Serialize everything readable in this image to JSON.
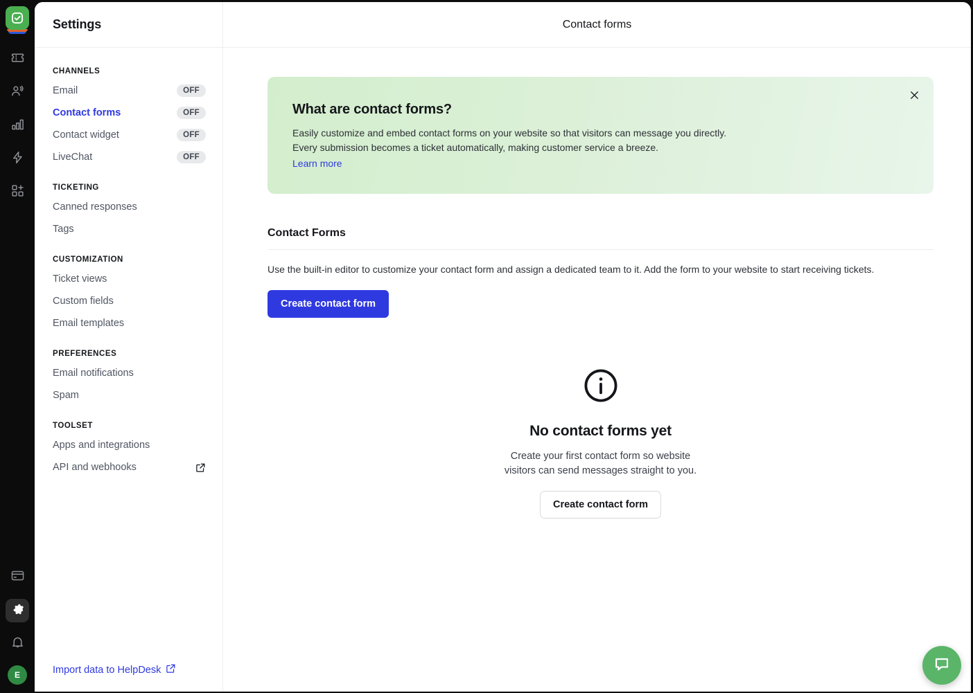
{
  "rail": {
    "logo_name": "helpdesk-logo",
    "items": [
      {
        "name": "tickets",
        "icon": "ticket-icon"
      },
      {
        "name": "teams",
        "icon": "people-icon"
      },
      {
        "name": "reports",
        "icon": "bar-chart-icon"
      },
      {
        "name": "automations",
        "icon": "lightning-bolt-icon"
      },
      {
        "name": "apps",
        "icon": "apps-grid-plus-icon"
      }
    ],
    "bottom_items": [
      {
        "name": "billing",
        "icon": "credit-card-icon",
        "active": false
      },
      {
        "name": "settings",
        "icon": "gear-icon",
        "active": true
      },
      {
        "name": "notifications",
        "icon": "bell-icon",
        "active": false
      }
    ],
    "avatar_initial": "E"
  },
  "topbar": {
    "settings_title": "Settings",
    "page_title": "Contact forms"
  },
  "sidebar": {
    "groups": [
      {
        "label": "CHANNELS",
        "items": [
          {
            "label": "Email",
            "badge": "OFF",
            "active": false
          },
          {
            "label": "Contact forms",
            "badge": "OFF",
            "active": true
          },
          {
            "label": "Contact widget",
            "badge": "OFF",
            "active": false
          },
          {
            "label": "LiveChat",
            "badge": "OFF",
            "active": false
          }
        ]
      },
      {
        "label": "TICKETING",
        "items": [
          {
            "label": "Canned responses",
            "badge": null,
            "active": false
          },
          {
            "label": "Tags",
            "badge": null,
            "active": false
          }
        ]
      },
      {
        "label": "CUSTOMIZATION",
        "items": [
          {
            "label": "Ticket views",
            "badge": null,
            "active": false
          },
          {
            "label": "Custom fields",
            "badge": null,
            "active": false
          },
          {
            "label": "Email templates",
            "badge": null,
            "active": false
          }
        ]
      },
      {
        "label": "PREFERENCES",
        "items": [
          {
            "label": "Email notifications",
            "badge": null,
            "active": false
          },
          {
            "label": "Spam",
            "badge": null,
            "active": false
          }
        ]
      },
      {
        "label": "TOOLSET",
        "items": [
          {
            "label": "Apps and integrations",
            "badge": null,
            "active": false
          },
          {
            "label": "API and webhooks",
            "badge": null,
            "active": false,
            "external": true
          }
        ]
      }
    ],
    "footer_link": "Import data to HelpDesk"
  },
  "banner": {
    "heading": "What are contact forms?",
    "text": "Easily customize and embed contact forms on your website so that visitors can message you directly. Every submission becomes a ticket automatically, making customer service a breeze.",
    "link": "Learn more",
    "close_label": "Close"
  },
  "section": {
    "heading": "Contact Forms",
    "description": "Use the built-in editor to customize your contact form and assign a dedicated team to it. Add the form to your website to start receiving tickets.",
    "primary_button": "Create contact form"
  },
  "empty_state": {
    "icon": "info-circle-icon",
    "heading": "No contact forms yet",
    "line1": "Create your first contact form so website",
    "line2": "visitors can send messages straight to you.",
    "button": "Create contact form"
  },
  "chat": {
    "launcher_label": "Open chat",
    "icon": "chat-bubble-icon"
  },
  "colors": {
    "accent_blue": "#2f39e0",
    "banner_green_from": "#d3eecd",
    "banner_green_to": "#e8f5ea",
    "rail_background": "#0c0c0c",
    "chat_green": "#5ab569",
    "badge_background": "#e8e9eb"
  }
}
